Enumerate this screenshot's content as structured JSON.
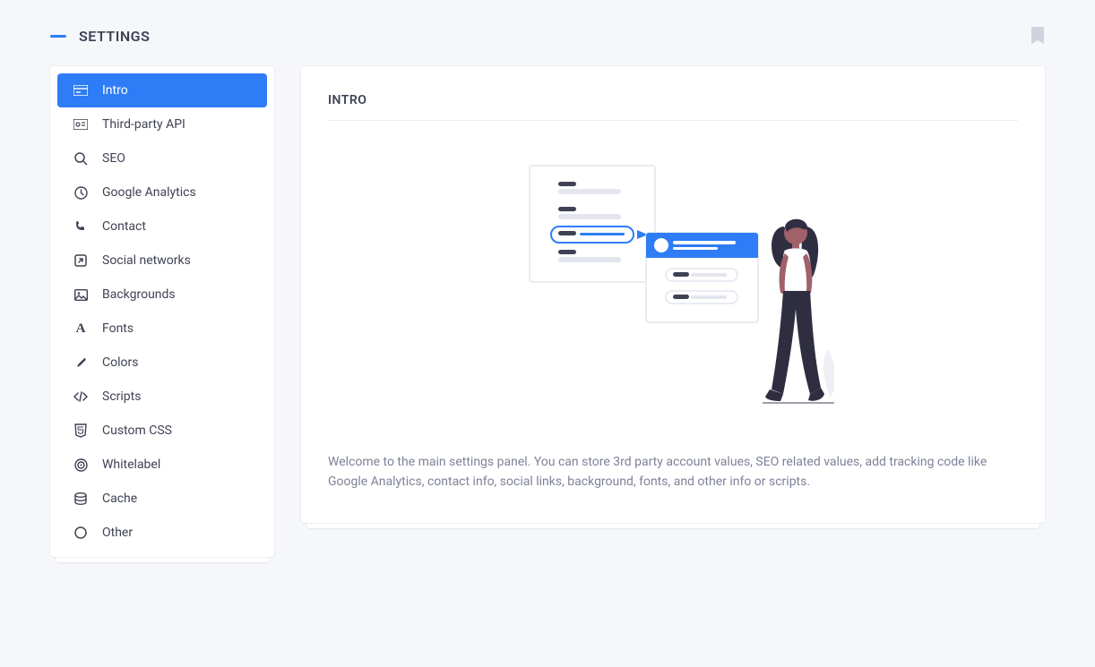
{
  "header": {
    "title": "SETTINGS"
  },
  "sidebar": {
    "items": [
      {
        "label": "Intro",
        "icon": "card-icon",
        "active": true
      },
      {
        "label": "Third-party API",
        "icon": "id-card-icon"
      },
      {
        "label": "SEO",
        "icon": "search-icon"
      },
      {
        "label": "Google Analytics",
        "icon": "clock-icon"
      },
      {
        "label": "Contact",
        "icon": "phone-icon"
      },
      {
        "label": "Social networks",
        "icon": "share-icon"
      },
      {
        "label": "Backgrounds",
        "icon": "image-icon"
      },
      {
        "label": "Fonts",
        "icon": "font-icon"
      },
      {
        "label": "Colors",
        "icon": "brush-icon"
      },
      {
        "label": "Scripts",
        "icon": "code-icon"
      },
      {
        "label": "Custom CSS",
        "icon": "css-icon"
      },
      {
        "label": "Whitelabel",
        "icon": "target-icon"
      },
      {
        "label": "Cache",
        "icon": "database-icon"
      },
      {
        "label": "Other",
        "icon": "circle-icon"
      }
    ]
  },
  "content": {
    "title": "INTRO",
    "description": "Welcome to the main settings panel. You can store 3rd party account values, SEO related values, add tracking code like Google Analytics, contact info, social links, background, fonts, and other info or scripts."
  }
}
